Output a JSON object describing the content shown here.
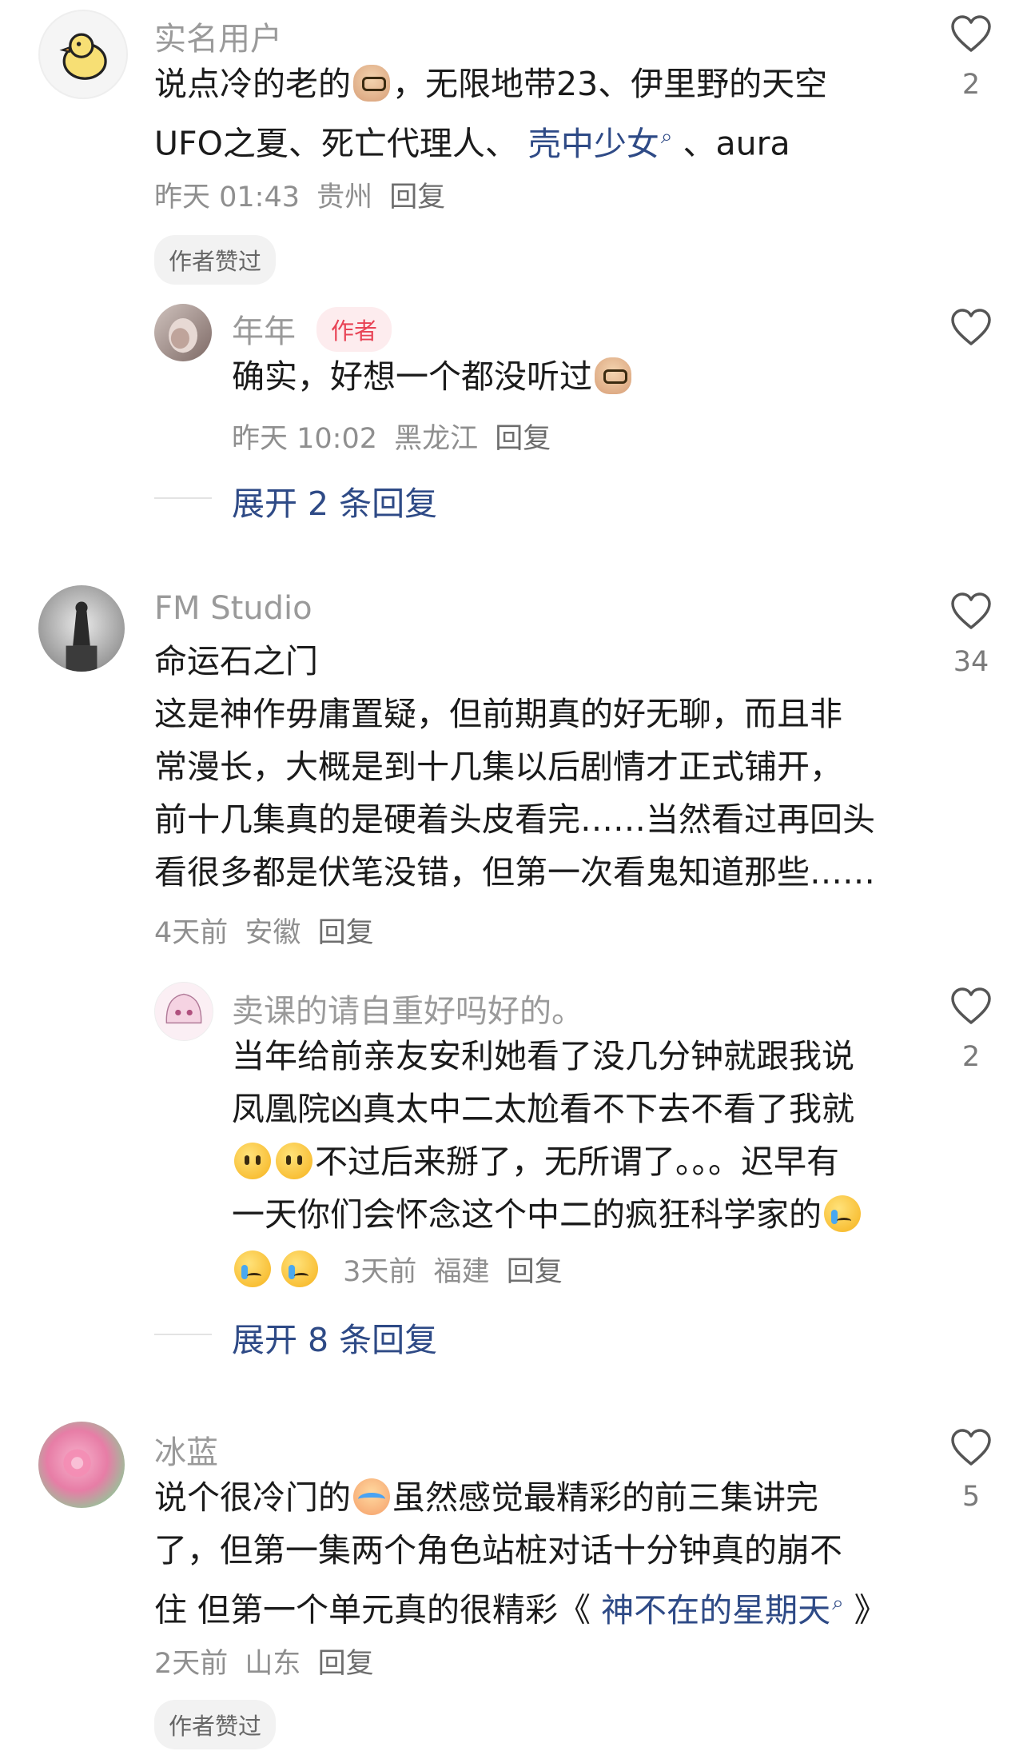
{
  "comments": [
    {
      "username": "实名用户",
      "text_lines": [
        [
          {
            "t": "说点冷的老的"
          },
          {
            "emoji": "bean"
          },
          {
            "t": "，无限地带23、伊里野的天空"
          }
        ],
        [
          {
            "t": "UFO之夏、死亡代理人、 "
          },
          {
            "link": "壳中少女"
          },
          {
            "t": " 、aura"
          }
        ]
      ],
      "time": "昨天 01:43",
      "location": "贵州",
      "reply_label": "回复",
      "likes": "2",
      "chip": "作者赞过",
      "reply": {
        "username": "年年",
        "badge": "作者",
        "text_lines": [
          [
            {
              "t": "确实，好想一个都没听过"
            },
            {
              "emoji": "bean"
            }
          ]
        ],
        "time": "昨天 10:02",
        "location": "黑龙江",
        "reply_label": "回复"
      },
      "expand_label": "展开 2 条回复"
    },
    {
      "username": "FM Studio",
      "text_lines": [
        [
          {
            "t": "命运石之门"
          }
        ],
        [
          {
            "t": "这是神作毋庸置疑，但前期真的好无聊，而且非"
          }
        ],
        [
          {
            "t": "常漫长，大概是到十几集以后剧情才正式铺开，"
          }
        ],
        [
          {
            "t": "前十几集真的是硬着头皮看完……当然看过再回头"
          }
        ],
        [
          {
            "t": "看很多都是伏笔没错，但第一次看鬼知道那些……"
          }
        ]
      ],
      "time": "4天前",
      "location": "安徽",
      "reply_label": "回复",
      "likes": "34",
      "reply": {
        "username": "卖课的请自重好吗好的。",
        "text_lines": [
          [
            {
              "t": "当年给前亲友安利她看了没几分钟就跟我说"
            }
          ],
          [
            {
              "t": "凤凰院凶真太中二太尬看不下去不看了我就"
            }
          ],
          [
            {
              "emoji": "face"
            },
            {
              "emoji": "face"
            },
            {
              "t": "不过后来掰了，无所谓了。。。迟早有"
            }
          ],
          [
            {
              "t": "一天你们会怀念这个中二的疯狂科学家的"
            },
            {
              "emoji": "cry"
            }
          ]
        ],
        "last_line_emojis": [
          "cry",
          "cry"
        ],
        "time": "3天前",
        "location": "福建",
        "reply_label": "回复",
        "likes": "2"
      },
      "expand_label": "展开 8 条回复"
    },
    {
      "username": "冰蓝",
      "text_lines": [
        [
          {
            "t": "说个很冷门的"
          },
          {
            "emoji": "sob"
          },
          {
            "t": "虽然感觉最精彩的前三集讲完"
          }
        ],
        [
          {
            "t": "了，但第一集两个角色站桩对话十分钟真的崩不"
          }
        ],
        [
          {
            "t": "住 但第一个单元真的很精彩《 "
          },
          {
            "link": "神不在的星期天"
          },
          {
            "t": " 》"
          }
        ]
      ],
      "time": "2天前",
      "location": "山东",
      "reply_label": "回复",
      "likes": "5",
      "chip": "作者赞过"
    }
  ],
  "colors": {
    "link": "#2e4a86",
    "author_badge_bg": "#fdecee",
    "author_badge_text": "#e84355",
    "meta_text": "#8f8f8f"
  },
  "icons": {
    "like": "heart-outline-icon",
    "link_search": "search-icon"
  }
}
